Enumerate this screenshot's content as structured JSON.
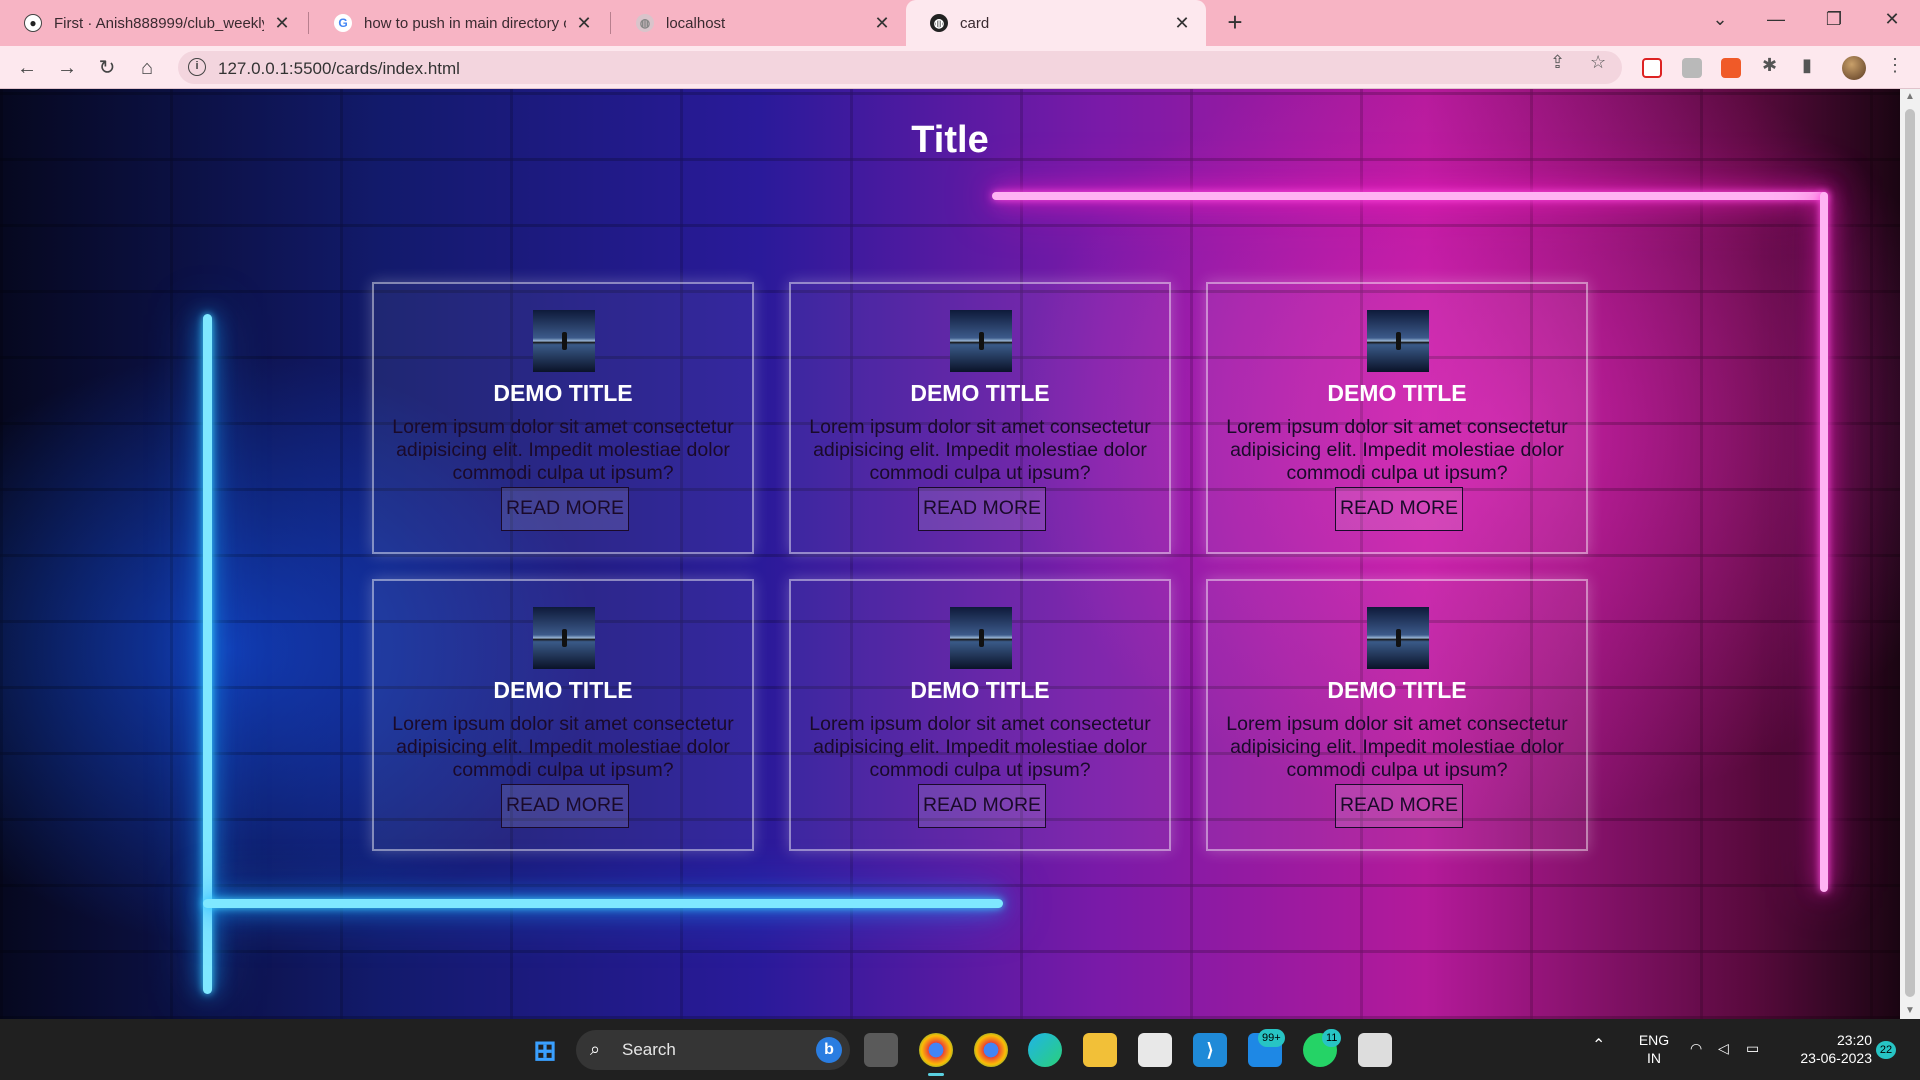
{
  "browser": {
    "tabs": [
      {
        "label": "First · Anish888999/club_weekly_",
        "icon": "github-icon"
      },
      {
        "label": "how to push in main directory or",
        "icon": "google-icon"
      },
      {
        "label": "localhost",
        "icon": "globe-icon"
      },
      {
        "label": "card",
        "icon": "globe-icon",
        "active": true
      }
    ],
    "new_tab": "+",
    "url": "127.0.0.1:5500/cards/index.html"
  },
  "page": {
    "title": "Title",
    "cards": [
      {
        "title": "DEMO TITLE",
        "text": "Lorem ipsum dolor sit amet consectetur adipisicing elit. Impedit molestiae dolor commodi culpa ut ipsum?",
        "button": "READ MORE"
      },
      {
        "title": "DEMO TITLE",
        "text": "Lorem ipsum dolor sit amet consectetur adipisicing elit. Impedit molestiae dolor commodi culpa ut ipsum?",
        "button": "READ MORE"
      },
      {
        "title": "DEMO TITLE",
        "text": "Lorem ipsum dolor sit amet consectetur adipisicing elit. Impedit molestiae dolor commodi culpa ut ipsum?",
        "button": "READ MORE"
      },
      {
        "title": "DEMO TITLE",
        "text": "Lorem ipsum dolor sit amet consectetur adipisicing elit. Impedit molestiae dolor commodi culpa ut ipsum?",
        "button": "READ MORE"
      },
      {
        "title": "DEMO TITLE",
        "text": "Lorem ipsum dolor sit amet consectetur adipisicing elit. Impedit molestiae dolor commodi culpa ut ipsum?",
        "button": "READ MORE"
      },
      {
        "title": "DEMO TITLE",
        "text": "Lorem ipsum dolor sit amet consectetur adipisicing elit. Impedit molestiae dolor commodi culpa ut ipsum?",
        "button": "READ MORE"
      }
    ]
  },
  "taskbar": {
    "search_label": "Search",
    "mail_badge": "99+",
    "whatsapp_badge": "11",
    "language": "ENG",
    "region": "IN",
    "time": "23:20",
    "date": "23-06-2023",
    "notification_count": "22"
  },
  "colors": {
    "tabbar": "#f7b4c4",
    "toolbar": "#fde8ee",
    "neon_blue": "#7fe8ff",
    "neon_pink": "#ffb3f3",
    "taskbar": "#202020"
  }
}
